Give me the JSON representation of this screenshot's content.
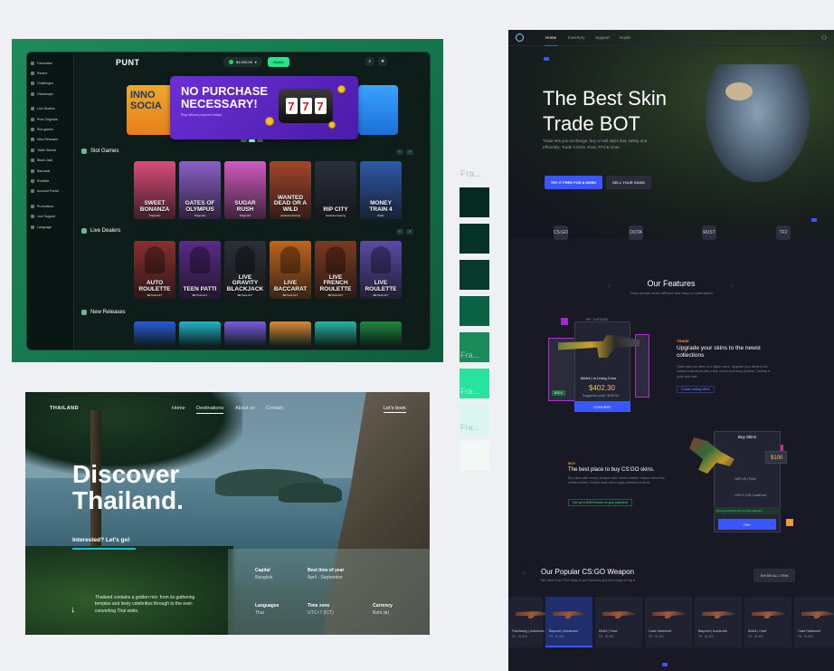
{
  "casino": {
    "sidebar": [
      {
        "label": "Favourites"
      },
      {
        "label": "Recent"
      },
      {
        "label": "Challenges"
      },
      {
        "label": "Giveaways"
      },
      {
        "label": "Live Dealers"
      },
      {
        "label": "Punt Originals"
      },
      {
        "label": "Slot games"
      },
      {
        "label": "New Releases"
      },
      {
        "label": "Table Games"
      },
      {
        "label": "Black Jack"
      },
      {
        "label": "Baccarat"
      },
      {
        "label": "Roulette"
      },
      {
        "label": "Account Funds"
      },
      {
        "label": "Promotions"
      },
      {
        "label": "Live Support"
      },
      {
        "label": "Language"
      }
    ],
    "logo": "PUNT",
    "balance": "$1,000.00",
    "wallet": "Wallet",
    "banner": {
      "left_text": "INNO SOCIA",
      "title": "NO PURCHASE NECESSARY!",
      "subtitle": "Play without payment today!"
    },
    "sections": {
      "slots": "Slot Games",
      "live": "Live Dealers",
      "new": "New Releases"
    },
    "slot_games": [
      {
        "name": "SWEET BONANZA",
        "provider": "Pragmatic",
        "color": "#d94c7a"
      },
      {
        "name": "GATES OF OLYMPUS",
        "provider": "Pragmatic",
        "color": "#8a5fc9"
      },
      {
        "name": "SUGAR RUSH",
        "provider": "Pragmatic",
        "color": "#d25bc1"
      },
      {
        "name": "WANTED DEAD OR A WILD",
        "provider": "Hacksaw Gaming",
        "color": "#a3452c"
      },
      {
        "name": "RIP CITY",
        "provider": "Hacksaw Gaming",
        "color": "#2a2f3d"
      },
      {
        "name": "MONEY TRAIN 4",
        "provider": "Relax",
        "color": "#2e5aa8"
      }
    ],
    "live_games": [
      {
        "name": "AUTO ROULETTE",
        "provider": "BETGALAXY",
        "color": "#8a2f2f"
      },
      {
        "name": "TEEN PATTI",
        "provider": "BETGALAXY",
        "color": "#5b2a8a"
      },
      {
        "name": "LIVE GRAVITY BLACKJACK",
        "provider": "BETGALAXY",
        "color": "#2b2f38"
      },
      {
        "name": "LIVE BACCARAT",
        "provider": "BETGALAXY",
        "color": "#c1641e"
      },
      {
        "name": "LIVE FRENCH ROULETTE",
        "provider": "BETGALAXY",
        "color": "#7d3a22"
      },
      {
        "name": "LIVE ROULETTE",
        "provider": "BETGALAXY",
        "color": "#5a4aa8"
      }
    ],
    "new_colors": [
      "#2a5bd6",
      "#22b5c9",
      "#7a5be0",
      "#d98a3a",
      "#2ab5a5",
      "#1e8a3a"
    ]
  },
  "swatches": {
    "label": "Fra...",
    "colors": [
      "#052a22",
      "#063328",
      "#073a2d",
      "#0a6144",
      "#1a8a5a",
      "#27e3a0",
      "#d9f7ee",
      "#f1f8f6"
    ],
    "overlay_labels": [
      {
        "index": 4,
        "text": "Fra..."
      },
      {
        "index": 5,
        "text": "Fra..."
      },
      {
        "index": 6,
        "text": "Fra..."
      }
    ]
  },
  "thailand": {
    "logo": "THAILAND",
    "nav": [
      "Home",
      "Destinations",
      "About us",
      "Contact"
    ],
    "cta_top": "Let's book",
    "heading_line1": "Discover",
    "heading_line2": "Thailand.",
    "interest": "Interested? Let's go!",
    "description": "Thailand contains a golden mix: from its gathering temples and lively celebrities through to the ever-converting Thai smile.",
    "info": [
      {
        "label": "Capital",
        "value": "Bangkok"
      },
      {
        "label": "Best time of year",
        "value": "April - September"
      },
      {
        "label": "Languages",
        "value": "Thai"
      },
      {
        "label": "Time zone",
        "value": "UTC+7 (ICT)"
      },
      {
        "label": "Currency",
        "value": "Baht (฿)"
      }
    ]
  },
  "skin": {
    "nav": [
      "Home",
      "Inventory",
      "Support",
      "Guide"
    ],
    "title_line1": "The Best Skin",
    "title_line2": "Trade BOT",
    "subtitle": "Trade lets you exchange, buy or sell skins fast, safely and efficiently. Trade CSGO, Rust, TF2 & more",
    "try_btn": "TRY IT FREE FOR A WEEK",
    "sell_btn": "SELL YOUR SKINS",
    "game_logos": [
      "CS:GO",
      "DOTA",
      "RUST",
      "TF2"
    ],
    "features_title": "Our Features",
    "features_sub": "Easy access make efficient and easy to understand",
    "card1": {
      "tag": "FN · 0.0710220",
      "name": "M4A4 | In Living Color",
      "price": "$402.30",
      "sub": "Suggested price: $445.00",
      "btn": "CONVERT",
      "side": "$10.5"
    },
    "trade_label": "TRADE",
    "trade_title": "Upgrade your skins to the newst collections",
    "trade_desc": "Trade skins for skins of a higher value. Upgrade your items to the newest collections with a fast, secure and easy process. Trading is quick and safe.",
    "trade_link": "Create trading offers",
    "buy_label": "BUY",
    "buy_title": "The best place to buy CS:GO skins.",
    "buy_desc": "Buy skins with money cheaper than steam market. Unique skins from verified sellers. Instant trade and a huge selection of items.",
    "buy_green": "Get up to $100 bonus on your payment",
    "buy_panel_title": "Buy Skins",
    "buy_price": "$100",
    "buy_rows": [
      "UMP-45 | Fade",
      "USP-S | Kill Confirmed"
    ],
    "buy_note": "You've got $10 bonus on your payment",
    "buy_btn": "PAY",
    "popular_title": "Our Popular CS:GO Weapon",
    "popular_sub": "We Have Over 7000 Skins in our Inventory and all is ready to buy it.",
    "show_all": "SHOW ALL ITEM",
    "weapons": [
      {
        "name": "Flashbang | Autotronic",
        "price": "FN · $1,500"
      },
      {
        "name": "Bayonet | Autotronic",
        "price": "FN · $1,500"
      },
      {
        "name": "M4A4 | Howl",
        "price": "FN · $1,500"
      },
      {
        "name": "Case Hardened",
        "price": "FN · $1,500"
      },
      {
        "name": "Bayonet | Autotronic",
        "price": "FN · $1,500"
      },
      {
        "name": "M4A4 | Howl",
        "price": "FN · $1,500"
      },
      {
        "name": "Case Hardened",
        "price": "FN · $1,500"
      }
    ]
  }
}
